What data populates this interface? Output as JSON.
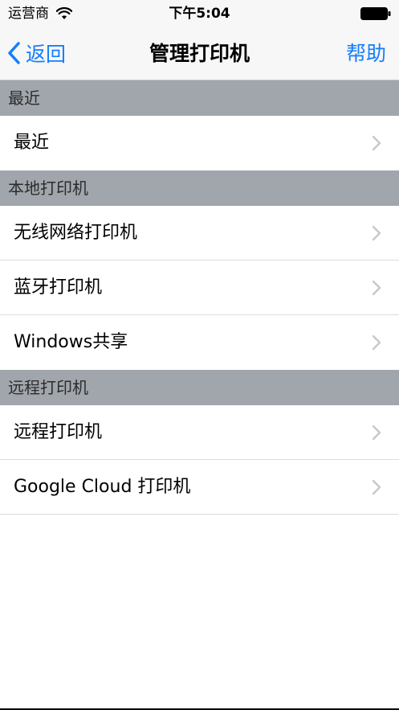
{
  "status_bar": {
    "carrier": "运营商",
    "time": "下午5:04"
  },
  "nav": {
    "back_label": "返回",
    "title": "管理打印机",
    "help_label": "帮助"
  },
  "sections": [
    {
      "header": "最近",
      "rows": [
        {
          "label": "最近"
        }
      ]
    },
    {
      "header": "本地打印机",
      "rows": [
        {
          "label": "无线网络打印机"
        },
        {
          "label": "蓝牙打印机"
        },
        {
          "label": "Windows共享"
        }
      ]
    },
    {
      "header": "远程打印机",
      "rows": [
        {
          "label": "远程打印机"
        },
        {
          "label": "Google Cloud 打印机"
        }
      ]
    }
  ],
  "colors": {
    "accent": "#157efb",
    "section_header_bg": "#a1a6ad",
    "chevron": "#c7c7cc"
  },
  "icons": {
    "wifi": "wifi-icon",
    "battery": "battery-icon",
    "back": "chevron-left-icon",
    "row_disclosure": "chevron-right-icon"
  }
}
